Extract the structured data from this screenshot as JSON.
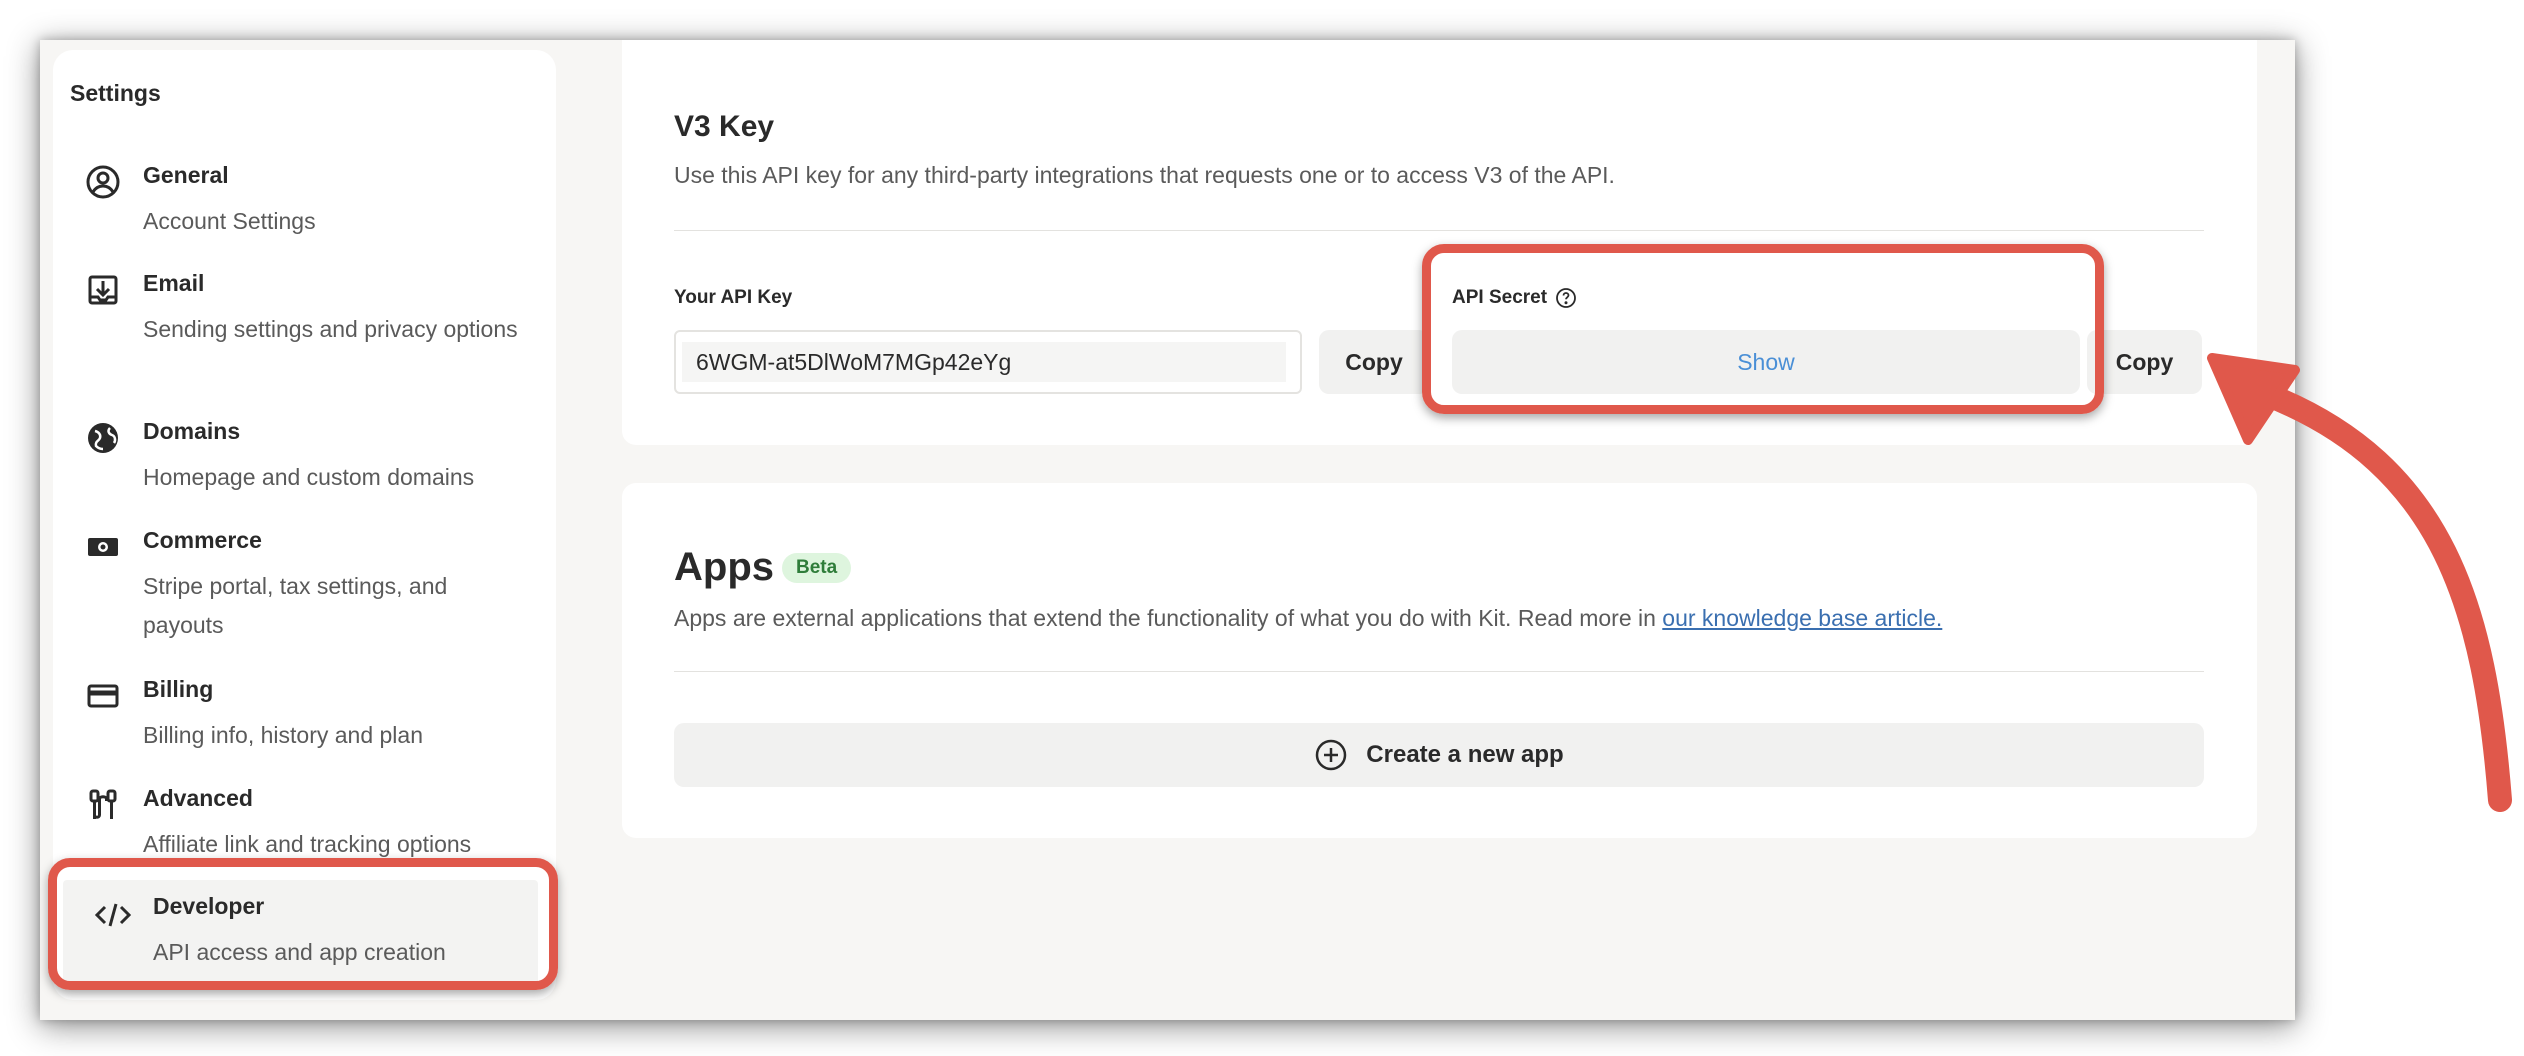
{
  "sidebar": {
    "title": "Settings",
    "items": [
      {
        "label": "General",
        "description": "Account Settings",
        "icon": "user-circle-icon"
      },
      {
        "label": "Email",
        "description": "Sending settings and privacy options",
        "icon": "inbox-download-icon"
      },
      {
        "label": "Domains",
        "description": "Homepage and custom domains",
        "icon": "globe-icon"
      },
      {
        "label": "Commerce",
        "description": "Stripe portal, tax settings, and payouts",
        "icon": "banknote-icon"
      },
      {
        "label": "Billing",
        "description": "Billing info, history and plan",
        "icon": "credit-card-icon"
      },
      {
        "label": "Advanced",
        "description": "Affiliate link and tracking options",
        "icon": "plug-icon"
      },
      {
        "label": "Developer",
        "description": "API access and app creation",
        "icon": "code-icon",
        "active": true
      }
    ]
  },
  "v3": {
    "title": "V3 Key",
    "description": "Use this API key for any third-party integrations that requests one or to access V3 of the API.",
    "api_key_label": "Your API Key",
    "api_key_value": "6WGM-at5DlWoM7MGp42eYg",
    "copy_label": "Copy",
    "api_secret_label": "API Secret",
    "show_label": "Show",
    "secret_copy_label": "Copy"
  },
  "apps": {
    "title": "Apps",
    "badge": "Beta",
    "description": "Apps are external applications that extend the functionality of what you do with Kit. Read more in ",
    "link_text": "our knowledge base article.",
    "create_label": "Create a new app"
  },
  "colors": {
    "annotation": "#e0584b",
    "link": "#3a6fb0",
    "show_link": "#4a8fd6",
    "badge_bg": "#def5de",
    "badge_text": "#2f7d3a"
  }
}
